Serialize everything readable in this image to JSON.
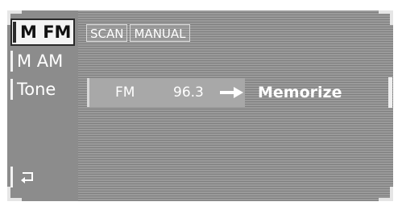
{
  "menu": {
    "items": [
      {
        "label": "M FM",
        "selected": true
      },
      {
        "label": "M AM",
        "selected": false
      },
      {
        "label": "Tone",
        "selected": false
      }
    ],
    "back_icon": "back-arrow-icon"
  },
  "modes": {
    "tabs": [
      {
        "label": "SCAN"
      },
      {
        "label": "MANUAL"
      }
    ]
  },
  "station": {
    "band": "FM",
    "frequency": "96.3",
    "arrow_icon": "right-arrow-icon",
    "action": "Memorize"
  },
  "colors": {
    "background": "#8f8f8f",
    "text": "#ffffff",
    "selected_bg": "#f4f4f4",
    "selected_text": "#111111"
  }
}
